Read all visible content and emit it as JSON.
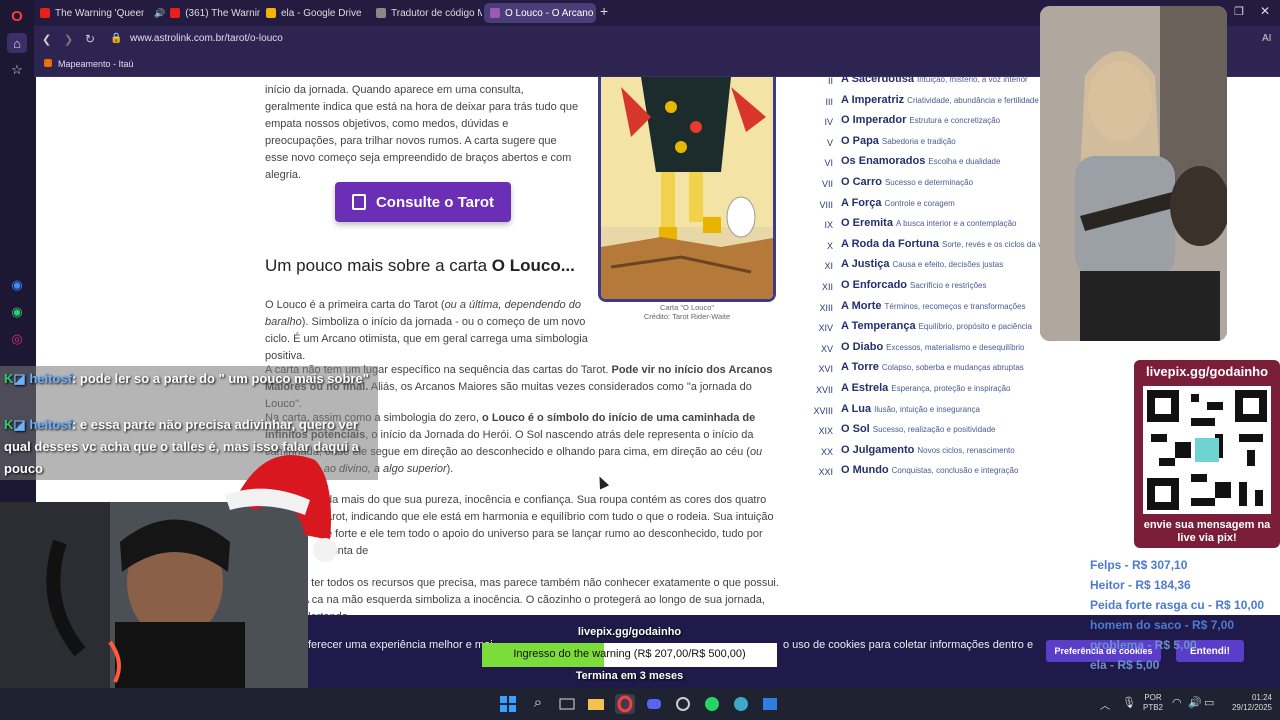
{
  "browser": {
    "tabs": [
      {
        "label": "The Warning 'Queen of th",
        "icon": "youtube-icon",
        "color": "#e62117"
      },
      {
        "label": "(361) The Warning | D",
        "icon": "youtube-icon",
        "color": "#e62117"
      },
      {
        "label": "ela - Google Drive",
        "icon": "google-drive-icon",
        "color": "#f4b400"
      },
      {
        "label": "Tradutor de código Morse",
        "icon": "page-icon",
        "color": "#888888"
      },
      {
        "label": "O Louco - O Arcano Maior",
        "icon": "astrolink-icon",
        "color": "#9b59b6"
      }
    ],
    "url": "www.astrolink.com.br/tarot/o-louco",
    "bookmark": "Mapeamento - Itaú",
    "ai_label": "AI"
  },
  "article": {
    "intro": "início da jornada. Quando aparece em uma consulta, geralmente indica que está na hora de deixar para trás tudo que empata nossos objetivos, como medos, dúvidas e preocupações, para trilhar novos rumos. A carta sugere que esse novo começo seja empreendido de braços abertos e com alegria.",
    "cta": "Consulte o Tarot",
    "subhead_prefix": "Um pouco mais sobre a carta ",
    "subhead_bold": "O Louco...",
    "card_caption": "Carta \"O Louco\"",
    "card_credit": "Crédito: Tarot Rider-Waite",
    "p1_a": "O Louco é a primeira carta do Tarot (",
    "p1_i": "ou a última, dependendo do baralho",
    "p1_b": "). Simboliza o início da jornada - ou o começo de um novo ciclo. É um Arcano otimista, que em geral carrega uma simbologia positiva.",
    "p2_a": "A carta não tem um lugar específico na sequência das cartas do Tarot. ",
    "p2_bold": "Pode vir no início dos Arcanos Maiores ou no final.",
    "p2_b": " Aliás, os Arcanos Maiores são muitas vezes considerados como \"a jornada do Louco\".",
    "p3_a": "Na carta, assim como a simbologia do zero, ",
    "p3_bold": "o Louco é o símbolo do início de uma caminhada de infinitos potenciais",
    "p3_b": ", o início da Jornada do Herói. O Sol nascendo atrás dele representa o início da caminhada, onde ele segue em direção ao desconhecido e olhando para cima, em direção ao céu (",
    "p3_i": "ou ao Espírito, ao divino, a algo superior",
    "p3_c": ").",
    "p4": "da mais do que sua pureza, inocência e confiança. Sua roupa contém as cores dos quatro arot, indicando que ele está em harmonia e equilíbrio com tudo o que o rodeia. Sua intuição é forte e ele tem todo o apoio do universo para se lançar rumo ao desconhecido, tudo por conta de",
    "p5": "e ter todos os recursos que precisa, mas parece também não conhecer exatamente o que possui. A ca na mão esquerda simboliza a inocência. O cãozinho o protegerá ao longo de sua jornada, alertando-"
  },
  "cards": [
    {
      "num": "II",
      "name": "A Sacerdotisa",
      "desc": "Intuição, mistério, a voz interior"
    },
    {
      "num": "III",
      "name": "A Imperatriz",
      "desc": "Criatividade, abundância e fertilidade"
    },
    {
      "num": "IV",
      "name": "O Imperador",
      "desc": "Estrutura e concretização"
    },
    {
      "num": "V",
      "name": "O Papa",
      "desc": "Sabedoria e tradição"
    },
    {
      "num": "VI",
      "name": "Os Enamorados",
      "desc": "Escolha e dualidade"
    },
    {
      "num": "VII",
      "name": "O Carro",
      "desc": "Sucesso e determinação"
    },
    {
      "num": "VIII",
      "name": "A Força",
      "desc": "Controle e coragem"
    },
    {
      "num": "IX",
      "name": "O Eremita",
      "desc": "A busca interior e a contemplação"
    },
    {
      "num": "X",
      "name": "A Roda da Fortuna",
      "desc": "Sorte, revés e os ciclos da vida"
    },
    {
      "num": "XI",
      "name": "A Justiça",
      "desc": "Causa e efeito, decisões justas"
    },
    {
      "num": "XII",
      "name": "O Enforcado",
      "desc": "Sacrifício e restrições"
    },
    {
      "num": "XIII",
      "name": "A Morte",
      "desc": "Términos, recomeços e transformações"
    },
    {
      "num": "XIV",
      "name": "A Temperança",
      "desc": "Equilíbrio, propósito e paciência"
    },
    {
      "num": "XV",
      "name": "O Diabo",
      "desc": "Excessos, materialismo e desequilíbrio"
    },
    {
      "num": "XVI",
      "name": "A Torre",
      "desc": "Colapso, soberba e mudanças abruptas"
    },
    {
      "num": "XVII",
      "name": "A Estrela",
      "desc": "Esperança, proteção e inspiração"
    },
    {
      "num": "XVIII",
      "name": "A Lua",
      "desc": "Ilusão, intuição e insegurança"
    },
    {
      "num": "XIX",
      "name": "O Sol",
      "desc": "Sucesso, realização e positividade"
    },
    {
      "num": "XX",
      "name": "O Julgamento",
      "desc": "Novos ciclos, renascimento"
    },
    {
      "num": "XXI",
      "name": "O Mundo",
      "desc": "Conquistas, conclusão e integração"
    }
  ],
  "chat": [
    {
      "user": "heitosf",
      "text": ": pode ler so a parte do \" um pouco mais sobre\""
    },
    {
      "user": "heitosf",
      "text": ": e essa parte não precisa adivinhar, quero ver qual desses vc acha que o talles é, mas isso falar daqui a pouco"
    }
  ],
  "stream": {
    "qr_title": "livepix.gg/godainho",
    "qr_caption": "envie sua mensagem na live via pix!",
    "donations": [
      "Felps - R$ 307,10",
      "Heitor - R$ 184,36",
      "Peida forte rasga cu - R$ 10,00",
      "homem do saco - R$ 7,00",
      "problema - R$ 5,00",
      "ela - R$ 5,00"
    ],
    "goal_url": "livepix.gg/godainho",
    "goal_text": "Ingresso do the warning (R$ 207,00/R$ 500,00)",
    "goal_progress": 0.414,
    "goal_footer": "Termina em 3 meses"
  },
  "cookie": {
    "text_a": "ferecer uma experiência melhor e mai",
    "text_b": "o uso de cookies para coletar informações dentro e",
    "prefs_button": "Preferência de cookies",
    "ok_button": "Entendi!"
  },
  "taskbar": {
    "lang": "POR",
    "layout": "PTB2",
    "time": "01:24",
    "date": "29/12/2025"
  }
}
